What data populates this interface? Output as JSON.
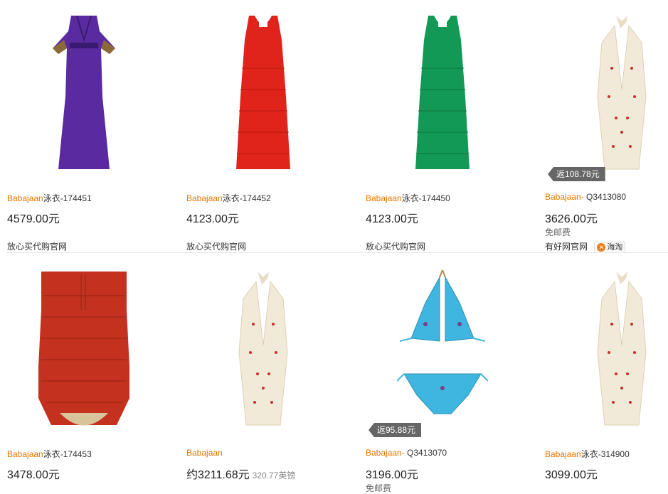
{
  "colors": {
    "brand_link": "#e77600",
    "rebate_bg": "#666666"
  },
  "products": [
    {
      "brand": "Babajaan",
      "code": "泳衣-174451",
      "price": "4579.00元",
      "store": "放心买代购官网",
      "image": "purple-maxi-dress"
    },
    {
      "brand": "Babajaan",
      "code": "泳衣-174452",
      "price": "4123.00元",
      "store": "放心买代购官网",
      "image": "red-fringe-dress"
    },
    {
      "brand": "Babajaan",
      "code": "泳衣-174450",
      "price": "4123.00元",
      "store": "放心买代购官网",
      "image": "green-fringe-dress"
    },
    {
      "brand": "Babajaan-",
      "code": " Q3413080",
      "price": "3626.00元",
      "shipping": "免邮费",
      "store": "有好网官网",
      "badge": "海淘",
      "rebate": "返108.78元",
      "image": "cream-halter-swimsuit"
    },
    {
      "brand": "Babajaan",
      "code": "泳衣-174453",
      "price": "3478.00元",
      "image": "red-bandeau-swimsuit"
    },
    {
      "brand": "Babajaan",
      "code": "",
      "price": "约3211.68元",
      "orig_price": "320.77英镑",
      "image": "cream-halter-swimsuit"
    },
    {
      "brand": "Babajaan-",
      "code": " Q3413070",
      "price": "3196.00元",
      "shipping": "免邮费",
      "rebate": "返95.88元",
      "image": "blue-bikini"
    },
    {
      "brand": "Babajaan",
      "code": "泳衣-314900",
      "price": "3099.00元",
      "image": "cream-halter-swimsuit"
    }
  ]
}
